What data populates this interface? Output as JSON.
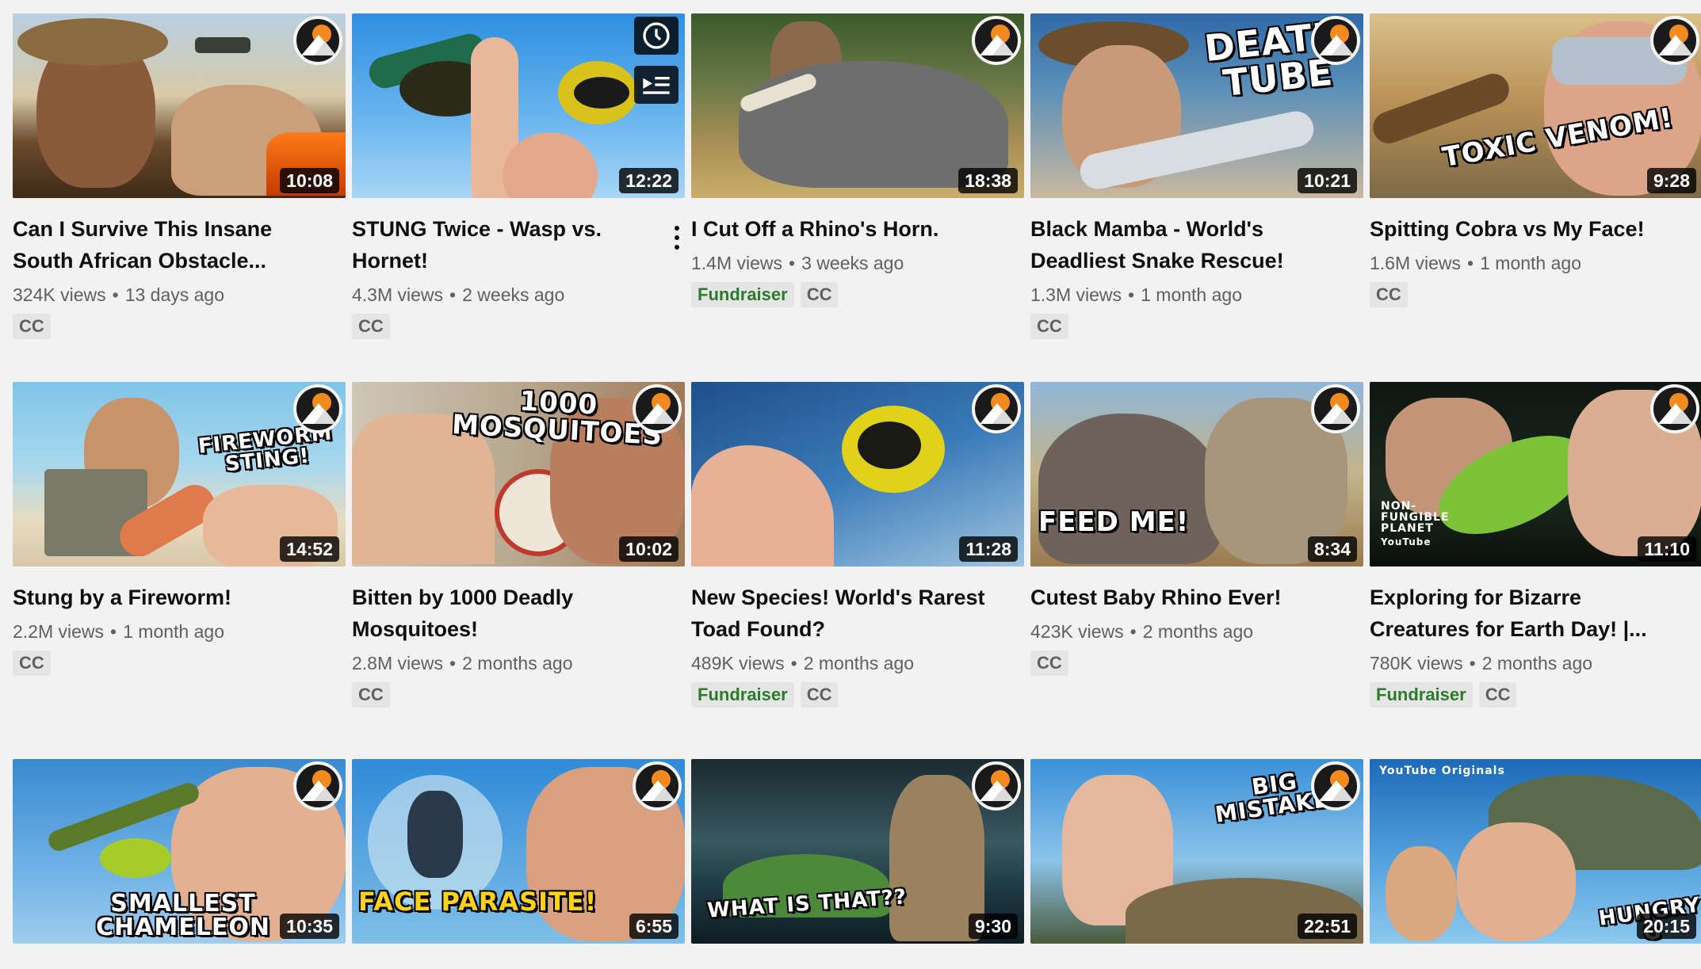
{
  "videos": [
    {
      "title": "Can I Survive This Insane South African Obstacle...",
      "views": "324K views",
      "age": "13 days ago",
      "duration": "10:08",
      "badges": [
        "CC"
      ],
      "caption": ""
    },
    {
      "title": "STUNG Twice - Wasp vs. Hornet!",
      "views": "4.3M views",
      "age": "2 weeks ago",
      "duration": "12:22",
      "badges": [
        "CC"
      ],
      "caption": ""
    },
    {
      "title": "I Cut Off a Rhino's Horn.",
      "views": "1.4M views",
      "age": "3 weeks ago",
      "duration": "18:38",
      "badges": [
        "Fundraiser",
        "CC"
      ],
      "caption": ""
    },
    {
      "title": "Black Mamba - World's Deadliest Snake Rescue!",
      "views": "1.3M views",
      "age": "1 month ago",
      "duration": "10:21",
      "badges": [
        "CC"
      ],
      "caption": "DEATH TUBE"
    },
    {
      "title": "Spitting Cobra vs My Face!",
      "views": "1.6M views",
      "age": "1 month ago",
      "duration": "9:28",
      "badges": [
        "CC"
      ],
      "caption": "TOXIC VENOM!"
    },
    {
      "title": "Stung by a Fireworm!",
      "views": "2.2M views",
      "age": "1 month ago",
      "duration": "14:52",
      "badges": [
        "CC"
      ],
      "caption": "FIREWORM STING!"
    },
    {
      "title": "Bitten by 1000 Deadly Mosquitoes!",
      "views": "2.8M views",
      "age": "2 months ago",
      "duration": "10:02",
      "badges": [
        "CC"
      ],
      "caption": "1000 MOSQUITOES"
    },
    {
      "title": "New Species! World's Rarest Toad Found?",
      "views": "489K views",
      "age": "2 months ago",
      "duration": "11:28",
      "badges": [
        "Fundraiser",
        "CC"
      ],
      "caption": ""
    },
    {
      "title": "Cutest Baby Rhino Ever!",
      "views": "423K views",
      "age": "2 months ago",
      "duration": "8:34",
      "badges": [
        "CC"
      ],
      "caption": "FEED ME!"
    },
    {
      "title": "Exploring for Bizarre Creatures for Earth Day! |...",
      "views": "780K views",
      "age": "2 months ago",
      "duration": "11:10",
      "badges": [
        "Fundraiser",
        "CC"
      ],
      "caption": "NON-FUNGIBLE PLANET"
    },
    {
      "title": "",
      "views": "",
      "age": "",
      "duration": "10:35",
      "badges": [],
      "caption": "SMALLEST CHAMELEON"
    },
    {
      "title": "",
      "views": "",
      "age": "",
      "duration": "6:55",
      "badges": [],
      "caption": "FACE PARASITE!"
    },
    {
      "title": "",
      "views": "",
      "age": "",
      "duration": "9:30",
      "badges": [],
      "caption": "WHAT IS THAT??"
    },
    {
      "title": "",
      "views": "",
      "age": "",
      "duration": "22:51",
      "badges": [],
      "caption": "BIG MISTAKE!"
    },
    {
      "title": "",
      "views": "",
      "age": "",
      "duration": "20:15",
      "badges": [],
      "caption": "HUNGRY G"
    }
  ],
  "thumb_extras": {
    "v9_youtube_label": "YouTube",
    "v15_originals_label": "YouTube Originals"
  },
  "colors": {
    "fundraiser": "#2c7b2c",
    "accent_orange": "#f28a1e"
  },
  "icons": {
    "watch_later": "clock-icon",
    "add_to_queue": "queue-icon",
    "more": "more-vert-icon"
  }
}
